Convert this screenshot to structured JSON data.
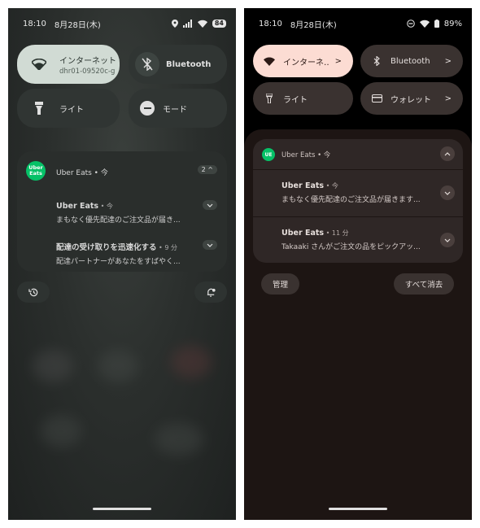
{
  "left": {
    "status": {
      "time": "18:10",
      "date": "8月28日(木)",
      "battery": "84"
    },
    "tiles": {
      "internet": {
        "label": "インターネット",
        "sub": "dhr01-09520c-g"
      },
      "bluetooth": {
        "label": "Bluetooth"
      },
      "light": {
        "label": "ライト"
      },
      "mode": {
        "label": "モード"
      }
    },
    "notification": {
      "app": "Uber Eats • 今",
      "logo": "Uber Eats",
      "count": "2",
      "items": [
        {
          "title": "Uber Eats",
          "meta": " • 今",
          "body": "まもなく優先配達のご注文品が届き..."
        },
        {
          "title": "配達の受け取りを迅速化する",
          "meta": " • 9 分",
          "body": "配達パートナーがあなたをすばやく..."
        }
      ]
    }
  },
  "right": {
    "status": {
      "time": "18:10",
      "date": "8月28日(木)",
      "battery": "89%"
    },
    "tiles": {
      "internet": {
        "label": "インターネ‥"
      },
      "bluetooth": {
        "label": "Bluetooth"
      },
      "light": {
        "label": "ライト"
      },
      "wallet": {
        "label": "ウォレット"
      }
    },
    "notification": {
      "app": "Uber Eats • 今",
      "logo": "UE",
      "items": [
        {
          "title": "Uber Eats",
          "meta": " • 今",
          "body": "まもなく優先配達のご注文品が届きます..."
        },
        {
          "title": "Uber Eats",
          "meta": " • 11 分",
          "body": "Takaaki さんがご注文の品をピックアッ..."
        }
      ]
    },
    "buttons": {
      "manage": "管理",
      "clear_all": "すべて消去"
    }
  },
  "colors": {
    "uber_green": "#06c167",
    "left_active_tile": "#d1dbd4",
    "right_active_tile": "#fcdcd3"
  }
}
